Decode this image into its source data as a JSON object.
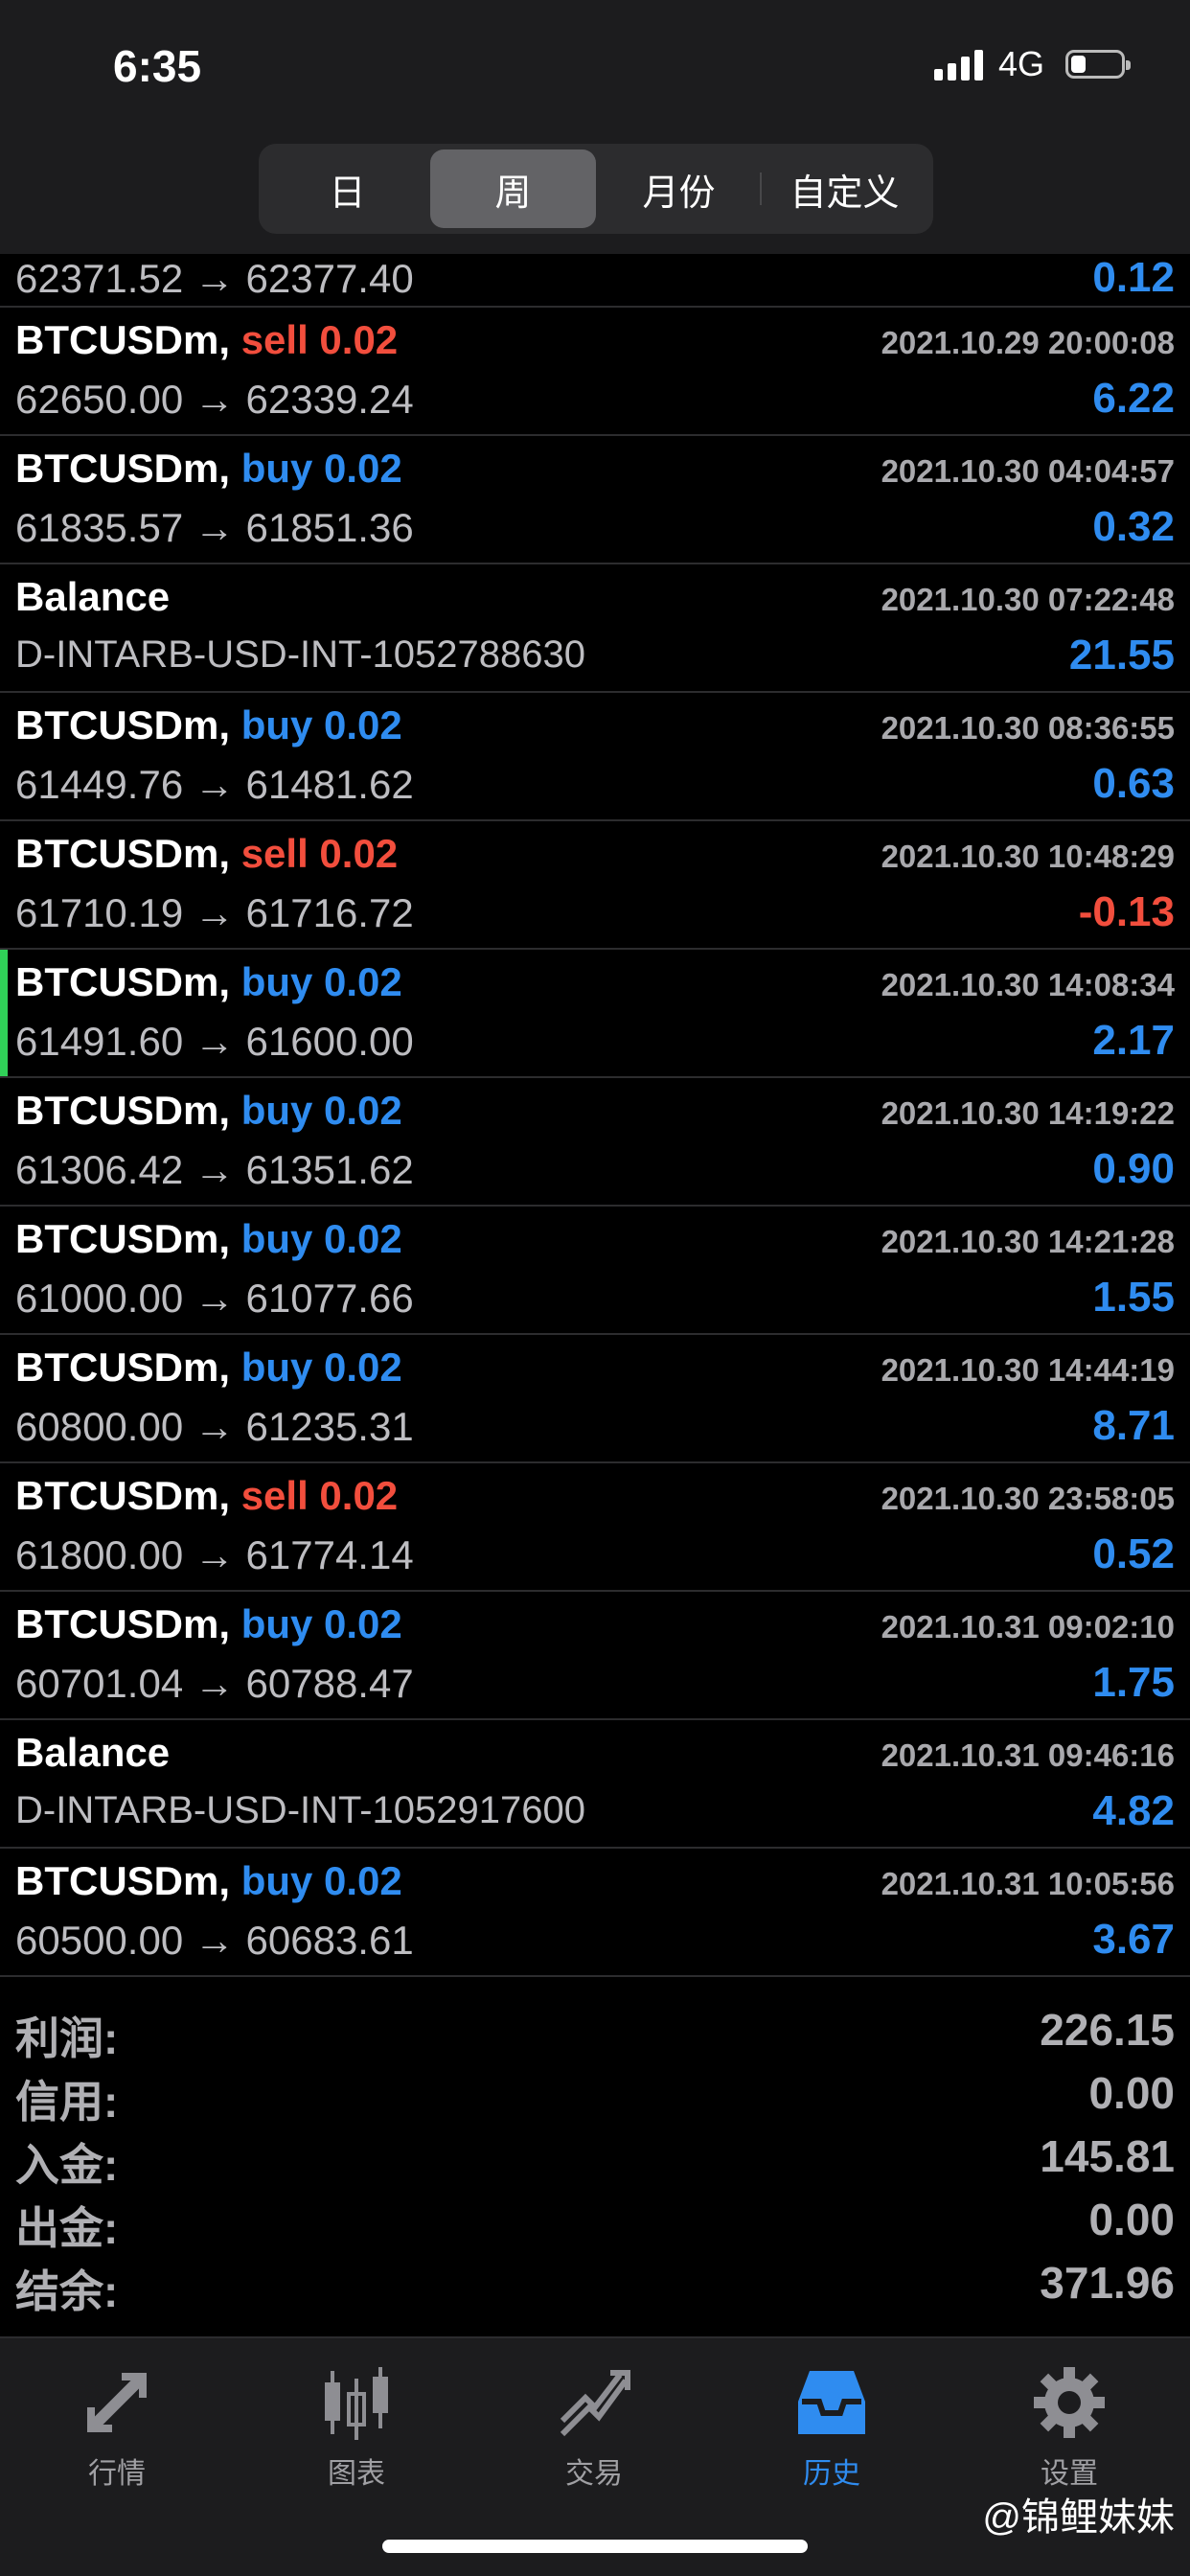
{
  "status": {
    "time": "6:35",
    "network": "4G",
    "battery_level": 0.3
  },
  "period_tabs": [
    {
      "label": "日",
      "active": false
    },
    {
      "label": "周",
      "active": true
    },
    {
      "label": "月份",
      "active": false
    },
    {
      "label": "自定义",
      "active": false
    }
  ],
  "deals": [
    {
      "prices": "62371.52 → 62377.40",
      "profit": "0.12",
      "sign": "pos"
    },
    {
      "symbol": "BTCUSDm,",
      "side": "sell",
      "volume": "0.02",
      "datetime": "2021.10.29 20:00:08",
      "prices": "62650.00 → 62339.24",
      "profit": "6.22",
      "sign": "pos"
    },
    {
      "symbol": "BTCUSDm,",
      "side": "buy",
      "volume": "0.02",
      "datetime": "2021.10.30 04:04:57",
      "prices": "61835.57 → 61851.36",
      "profit": "0.32",
      "sign": "pos"
    },
    {
      "type": "balance",
      "symbol": "Balance",
      "datetime": "2021.10.30 07:22:48",
      "prices": "D-INTARB-USD-INT-1052788630",
      "profit": "21.55",
      "sign": "pos"
    },
    {
      "symbol": "BTCUSDm,",
      "side": "buy",
      "volume": "0.02",
      "datetime": "2021.10.30 08:36:55",
      "prices": "61449.76 → 61481.62",
      "profit": "0.63",
      "sign": "pos"
    },
    {
      "symbol": "BTCUSDm,",
      "side": "sell",
      "volume": "0.02",
      "datetime": "2021.10.30 10:48:29",
      "prices": "61710.19 → 61716.72",
      "profit": "-0.13",
      "sign": "neg"
    },
    {
      "symbol": "BTCUSDm,",
      "side": "buy",
      "volume": "0.02",
      "datetime": "2021.10.30 14:08:34",
      "prices": "61491.60 → 61600.00",
      "profit": "2.17",
      "sign": "pos",
      "selected": true
    },
    {
      "symbol": "BTCUSDm,",
      "side": "buy",
      "volume": "0.02",
      "datetime": "2021.10.30 14:19:22",
      "prices": "61306.42 → 61351.62",
      "profit": "0.90",
      "sign": "pos"
    },
    {
      "symbol": "BTCUSDm,",
      "side": "buy",
      "volume": "0.02",
      "datetime": "2021.10.30 14:21:28",
      "prices": "61000.00 → 61077.66",
      "profit": "1.55",
      "sign": "pos"
    },
    {
      "symbol": "BTCUSDm,",
      "side": "buy",
      "volume": "0.02",
      "datetime": "2021.10.30 14:44:19",
      "prices": "60800.00 → 61235.31",
      "profit": "8.71",
      "sign": "pos"
    },
    {
      "symbol": "BTCUSDm,",
      "side": "sell",
      "volume": "0.02",
      "datetime": "2021.10.30 23:58:05",
      "prices": "61800.00 → 61774.14",
      "profit": "0.52",
      "sign": "pos"
    },
    {
      "symbol": "BTCUSDm,",
      "side": "buy",
      "volume": "0.02",
      "datetime": "2021.10.31 09:02:10",
      "prices": "60701.04 → 60788.47",
      "profit": "1.75",
      "sign": "pos"
    },
    {
      "type": "balance",
      "symbol": "Balance",
      "datetime": "2021.10.31 09:46:16",
      "prices": "D-INTARB-USD-INT-1052917600",
      "profit": "4.82",
      "sign": "pos"
    },
    {
      "symbol": "BTCUSDm,",
      "side": "buy",
      "volume": "0.02",
      "datetime": "2021.10.31 10:05:56",
      "prices": "60500.00 → 60683.61",
      "profit": "3.67",
      "sign": "pos"
    }
  ],
  "summary": [
    {
      "label": "利润:",
      "value": "226.15"
    },
    {
      "label": "信用:",
      "value": "0.00"
    },
    {
      "label": "入金:",
      "value": "145.81"
    },
    {
      "label": "出金:",
      "value": "0.00"
    },
    {
      "label": "结余:",
      "value": "371.96"
    }
  ],
  "tabbar": [
    {
      "label": "行情",
      "icon": "quotes-icon",
      "active": false
    },
    {
      "label": "图表",
      "icon": "chart-icon",
      "active": false
    },
    {
      "label": "交易",
      "icon": "trade-icon",
      "active": false
    },
    {
      "label": "历史",
      "icon": "history-icon",
      "active": true
    },
    {
      "label": "设置",
      "icon": "settings-icon",
      "active": false
    }
  ],
  "watermark": "@锦鲤妹妹",
  "colors": {
    "buy": "#2f8cf0",
    "sell": "#f24e3d",
    "active_tab": "#2f8cf0",
    "selected_marker": "#30d158"
  }
}
